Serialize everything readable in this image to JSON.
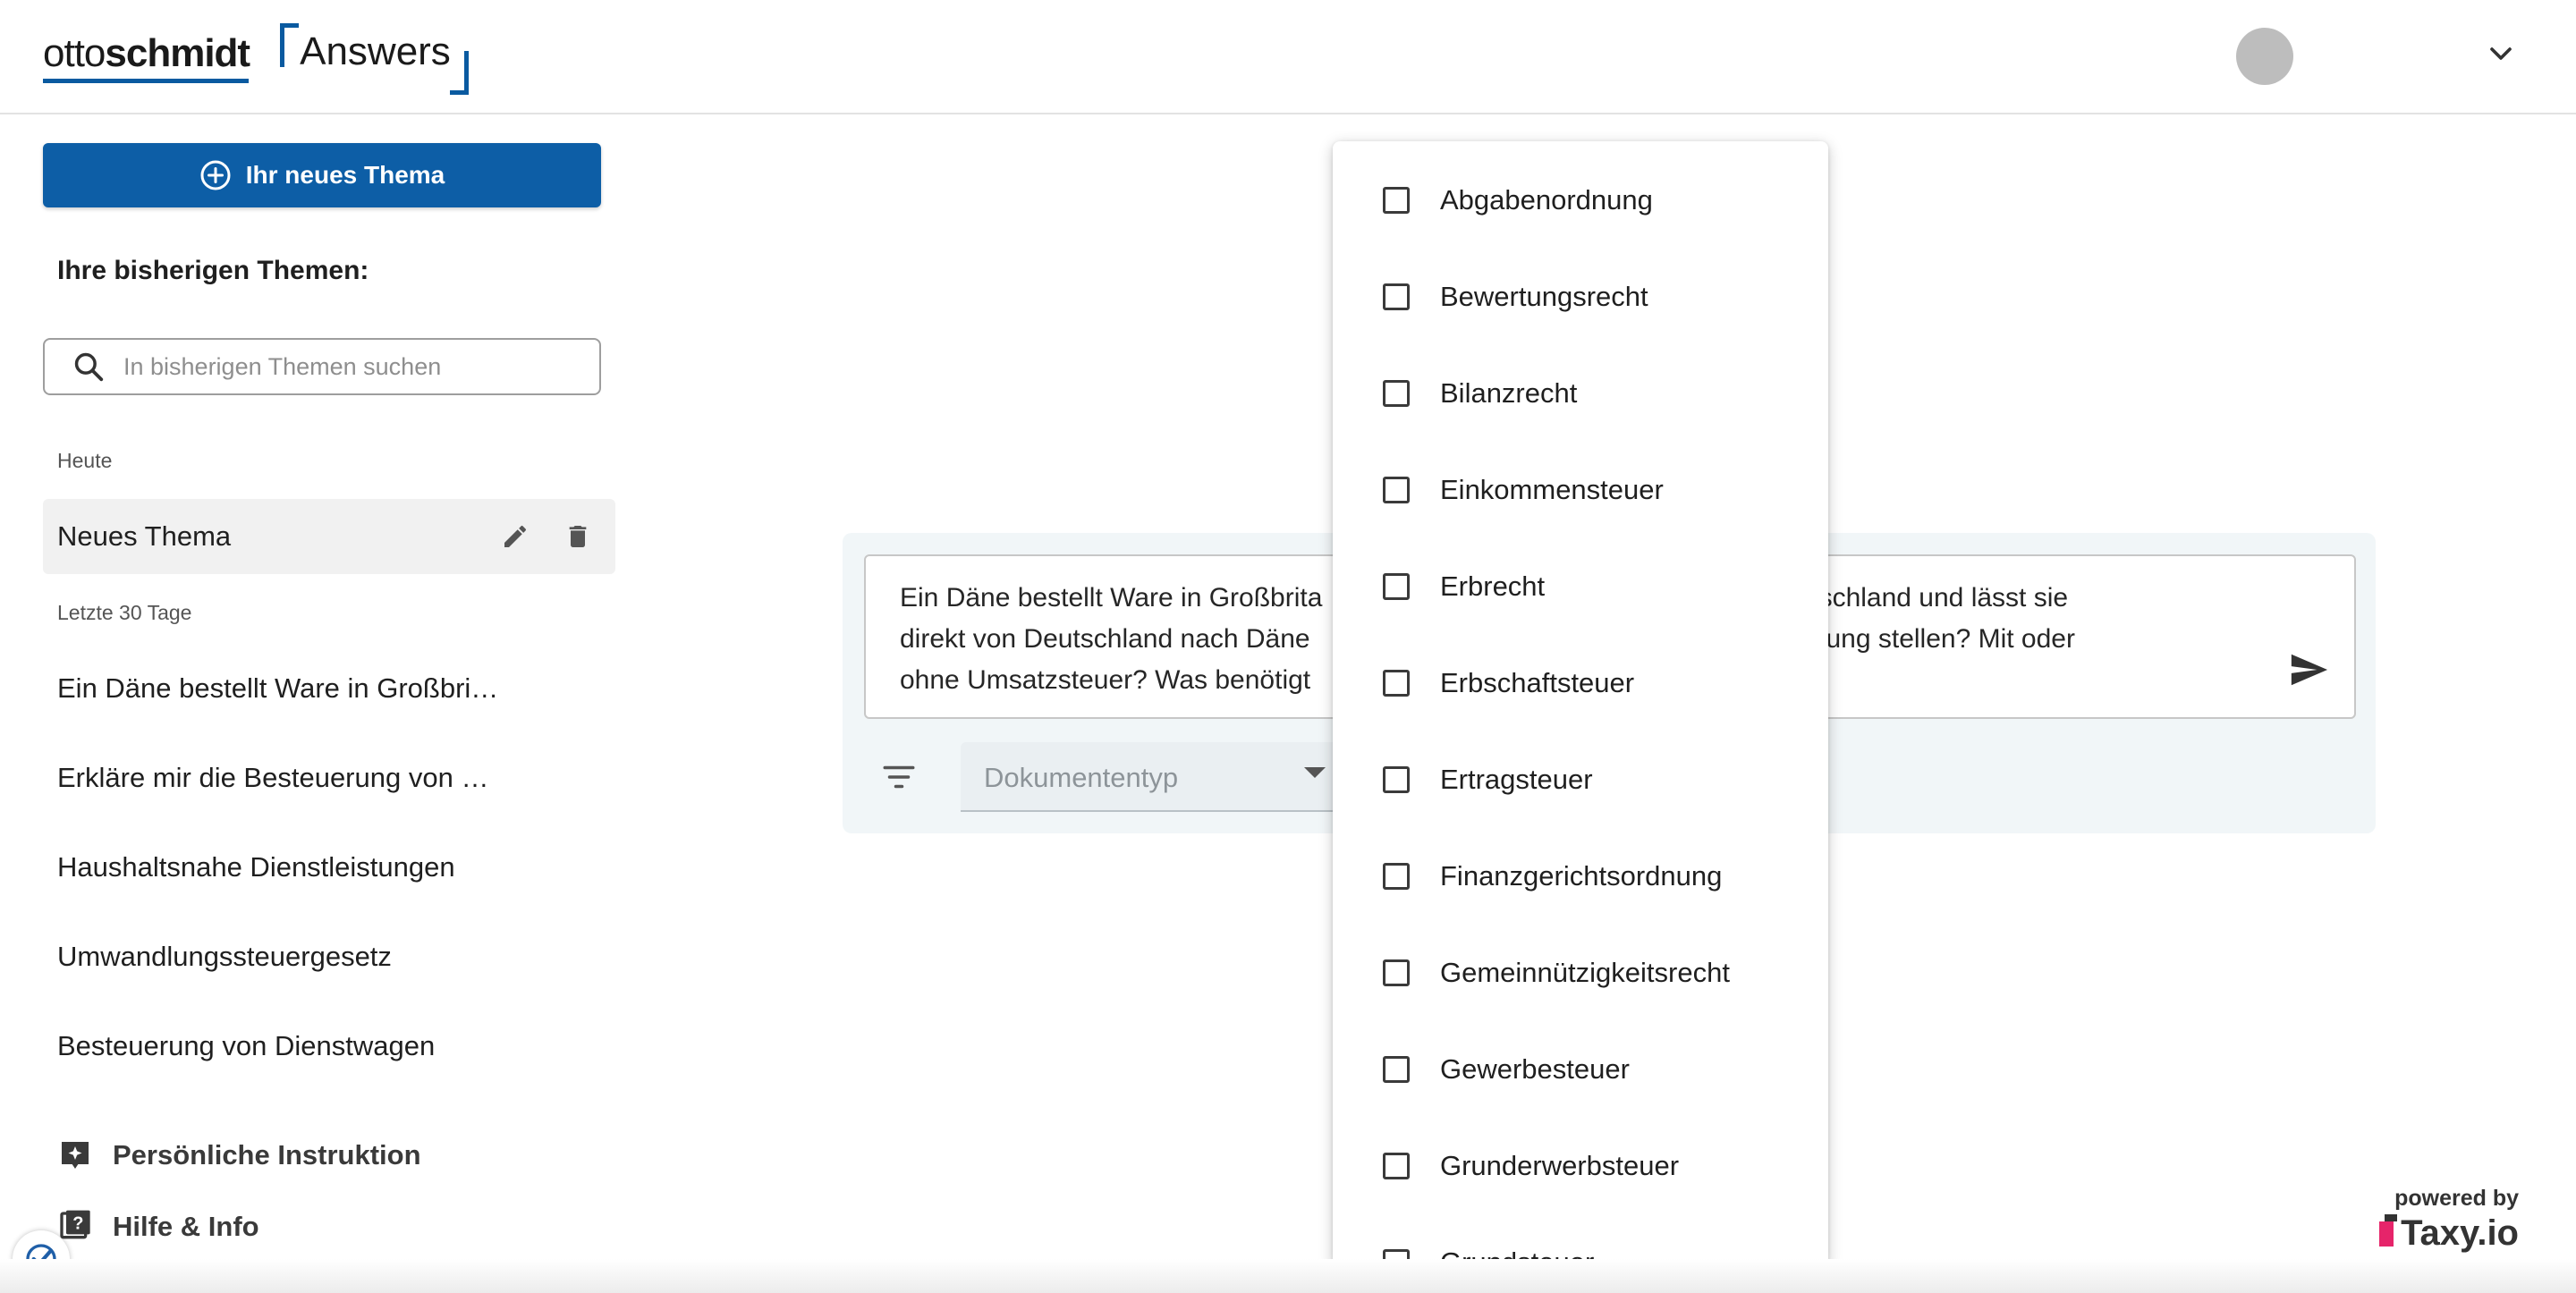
{
  "header": {
    "logo_part1": "otto",
    "logo_part2": "schmidt",
    "logo_answers": "Answers"
  },
  "sidebar": {
    "new_topic_label": "Ihr neues Thema",
    "section_title": "Ihre bisherigen Themen:",
    "search_placeholder": "In bisherigen Themen suchen",
    "group_today": "Heute",
    "active_topic": "Neues Thema",
    "group_last30": "Letzte 30 Tage",
    "topics": [
      "Ein Däne bestellt Ware in Großbri…",
      "Erkläre mir die Besteuerung von …",
      "Haushaltsnahe Dienstleistungen",
      "Umwandlungssteuergesetz",
      "Besteuerung von Dienstwagen"
    ],
    "personal_instruction": "Persönliche Instruktion",
    "help_info": "Hilfe & Info"
  },
  "composer": {
    "line1": "Ein Däne bestellt Ware in Großbrita                                                 are in Deutschland und lässt sie",
    "line2": "direkt von Deutschland nach Däne                                                   eine Rechnung stellen? Mit oder",
    "line3": "ohne Umsatzsteuer? Was benötigt",
    "doc_type_placeholder": "Dokumententyp"
  },
  "dropdown": {
    "items": [
      "Abgabenordnung",
      "Bewertungsrecht",
      "Bilanzrecht",
      "Einkommensteuer",
      "Erbrecht",
      "Erbschaftsteuer",
      "Ertragsteuer",
      "Finanzgerichtsordnung",
      "Gemeinnützigkeitsrecht",
      "Gewerbesteuer",
      "Grunderwerbsteuer",
      "Grundsteuer"
    ]
  },
  "footer": {
    "powered_by": "powered by",
    "brand": "Taxy.io"
  },
  "colors": {
    "primary": "#0d5ea6",
    "brand_pink": "#e6246a"
  }
}
